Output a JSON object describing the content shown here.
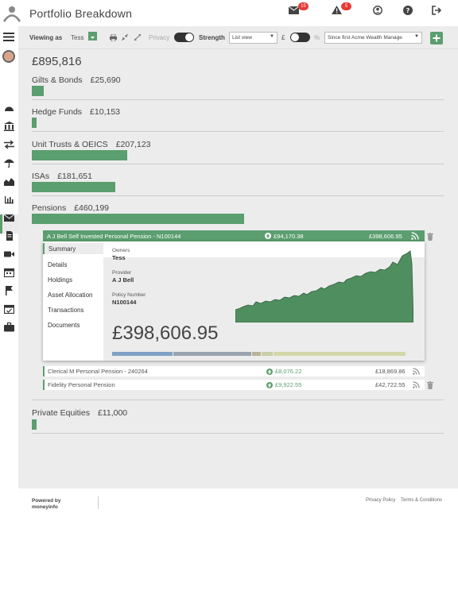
{
  "header": {
    "title": "Portfolio Breakdown",
    "mail_count": "15",
    "alert_count": "5"
  },
  "toolbar": {
    "viewing_as_label": "Viewing as",
    "viewing_as_value": "Tess",
    "privacy_label": "Privacy",
    "strength_label": "Strength",
    "view_select": "List view",
    "currency_label": "£",
    "percent_label": "%",
    "since_select": "Since first Acme Wealth Manage"
  },
  "portfolio": {
    "total": "£895,816",
    "categories": [
      {
        "name": "Gilts & Bonds",
        "value": "£25,690",
        "share": 0.028
      },
      {
        "name": "Hedge Funds",
        "value": "£10,153",
        "share": 0.011
      },
      {
        "name": "Unit Trusts & OEICS",
        "value": "£207,123",
        "share": 0.225
      },
      {
        "name": "ISAs",
        "value": "£181,651",
        "share": 0.197
      },
      {
        "name": "Pensions",
        "value": "£460,199",
        "share": 0.5
      },
      {
        "name": "Private Equities",
        "value": "£11,000",
        "share": 0.012
      }
    ]
  },
  "pension_detail": {
    "header_name": "A J Bell Self Invested Personal Pension - N100144",
    "growth": "£94,170.38",
    "value": "£398,606.95",
    "tabs": [
      "Summary",
      "Details",
      "Holdings",
      "Asset Allocation",
      "Transactions",
      "Documents"
    ],
    "owners_label": "Owners",
    "owners_value": "Tess",
    "provider_label": "Provider",
    "provider_value": "A J Bell",
    "policy_label": "Policy Number",
    "policy_value": "N100144",
    "big_value": "£398,606.95",
    "allocation_colors": [
      "#7ea2c6",
      "#9aa4ad",
      "#b7b39a",
      "#c9d0a8",
      "#d4d7a8"
    ],
    "accent_color": "#5b9e6f"
  },
  "sub_pensions": [
    {
      "name": "Clerical M Personal Pension - 240264",
      "growth": "£8,076.22",
      "value": "£18,869.86"
    },
    {
      "name": "Fidelity Personal Pension",
      "growth": "£9,922.55",
      "value": "£42,722.55"
    }
  ],
  "footer": {
    "powered_by": "Powered by",
    "brand": "moneyinfo",
    "privacy": "Privacy Policy",
    "terms": "Terms & Conditions"
  },
  "icons": [
    "logo-icon",
    "mail-icon",
    "alert-icon",
    "user-icon",
    "help-icon",
    "logout-icon",
    "menu-icon",
    "avatar",
    "print-icon",
    "shrink-icon",
    "expand-icon",
    "add-icon",
    "rss-icon",
    "trash-icon",
    "growth-icon"
  ]
}
